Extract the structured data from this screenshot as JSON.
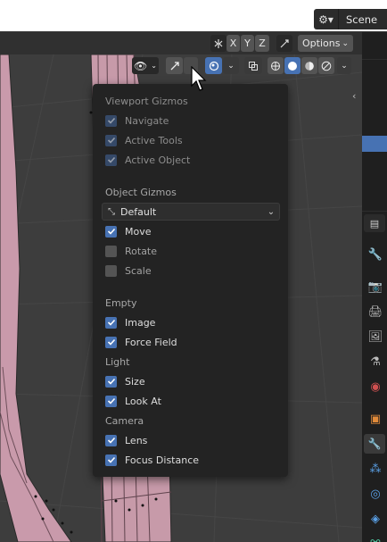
{
  "topbar": {
    "scene_label": "Scene",
    "scene_icon": "scene-icon"
  },
  "header": {
    "axis_x": "X",
    "axis_y": "Y",
    "axis_z": "Z",
    "options_label": "Options"
  },
  "popup": {
    "viewport_gizmos_title": "Viewport Gizmos",
    "navigate": "Navigate",
    "active_tools": "Active Tools",
    "active_object": "Active Object",
    "object_gizmos_title": "Object Gizmos",
    "orientation_value": "Default",
    "move": "Move",
    "rotate": "Rotate",
    "scale": "Scale",
    "empty_title": "Empty",
    "image": "Image",
    "force_field": "Force Field",
    "light_title": "Light",
    "size": "Size",
    "look_at": "Look At",
    "camera_title": "Camera",
    "lens": "Lens",
    "focus_distance": "Focus Distance"
  },
  "state": {
    "navigate": true,
    "active_tools": true,
    "active_object": true,
    "move": true,
    "rotate": false,
    "scale": false,
    "image": true,
    "force_field": true,
    "size": true,
    "look_at": true,
    "lens": true,
    "focus_distance": true
  },
  "colors": {
    "accent": "#4772b3",
    "popup_bg": "#232323",
    "mesh": "#c79aa9"
  }
}
